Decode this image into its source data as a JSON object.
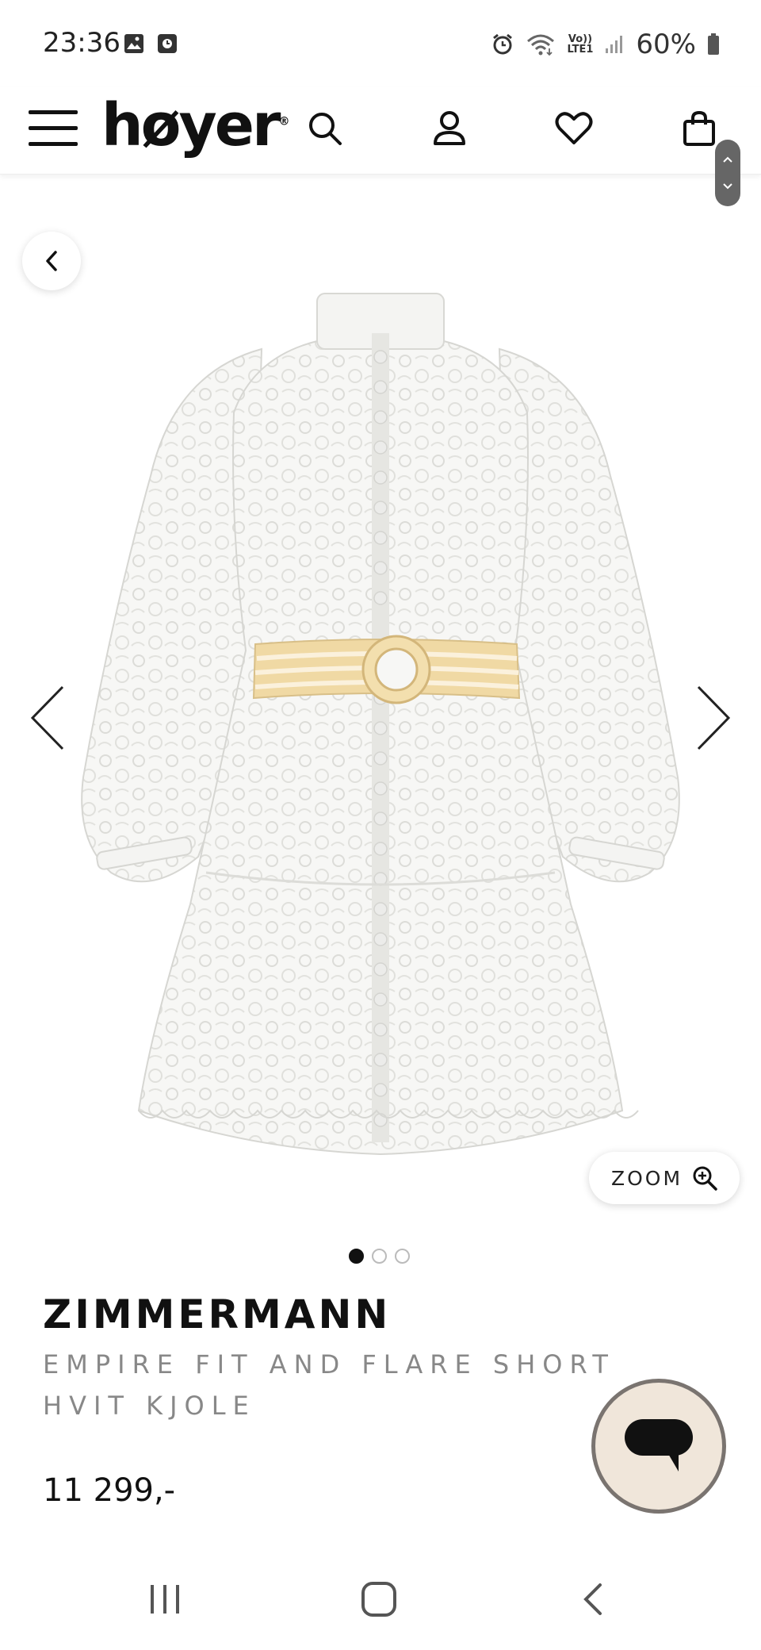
{
  "status_bar": {
    "time": "23:36",
    "battery_percent": "60%",
    "network_label_top": "Vo))",
    "network_label_bottom": "LTE1",
    "icons": [
      "gallery-icon",
      "media-icon",
      "alarm-icon",
      "wifi-icon",
      "signal-icon",
      "battery-icon"
    ]
  },
  "header": {
    "logo": "høyer",
    "logo_mark": "®",
    "icons": [
      "menu-icon",
      "search-icon",
      "account-icon",
      "wishlist-icon",
      "bag-icon"
    ]
  },
  "gallery": {
    "zoom_label": "ZOOM",
    "image_count": 3,
    "active_index": 0
  },
  "product": {
    "brand": "ZIMMERMANN",
    "name": "EMPIRE FIT AND FLARE SHORT HVIT KJOLE",
    "price": "11 299,-"
  },
  "colors": {
    "text": "#111111",
    "muted": "#888888",
    "chat_bg": "#f0e6da",
    "chat_border": "#7a7470",
    "belt": "#f0d9a4"
  }
}
